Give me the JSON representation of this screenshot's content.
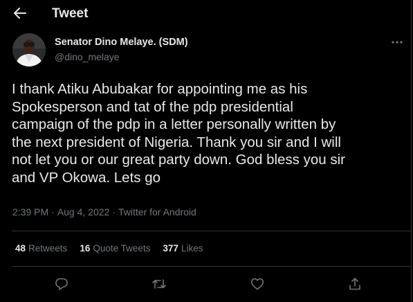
{
  "header": {
    "title": "Tweet"
  },
  "author": {
    "name": "Senator Dino Melaye. (SDM)",
    "handle": "@dino_melaye"
  },
  "tweet": {
    "lines": [
      "I thank Atiku Abubakar for appointing me as his",
      "Spokesperson and tat of the pdp presidential",
      "campaign of the pdp in a letter personally written by",
      "the next president of Nigeria. Thank you sir and I will",
      "not let you or our great party down. God bless you sir",
      "and VP Okowa. Lets go"
    ],
    "time": "2:39 PM",
    "date": "Aug 4, 2022",
    "separator": "·",
    "source": "Twitter for Android"
  },
  "stats": {
    "retweets": {
      "count": "48",
      "label": "Retweets"
    },
    "quotes": {
      "count": "16",
      "label": "Quote Tweets"
    },
    "likes": {
      "count": "377",
      "label": "Likes"
    }
  },
  "icons": {
    "back": "arrow-left-icon",
    "more": "more-icon",
    "reply": "reply-icon",
    "retweet": "retweet-icon",
    "like": "heart-icon",
    "share": "share-icon"
  },
  "colors": {
    "background": "#000000",
    "text": "#e7e9ea",
    "secondary": "#71767b",
    "border": "#2f3336"
  }
}
